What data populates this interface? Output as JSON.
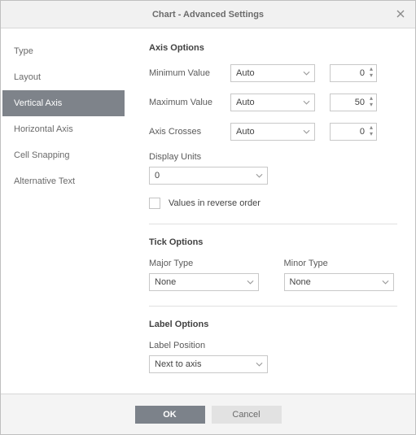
{
  "title": "Chart - Advanced Settings",
  "sidebar": {
    "items": [
      {
        "label": "Type"
      },
      {
        "label": "Layout"
      },
      {
        "label": "Vertical Axis"
      },
      {
        "label": "Horizontal Axis"
      },
      {
        "label": "Cell Snapping"
      },
      {
        "label": "Alternative Text"
      }
    ],
    "active_index": 2
  },
  "axis_options": {
    "heading": "Axis Options",
    "min_label": "Minimum Value",
    "min_mode": "Auto",
    "min_value": "0",
    "max_label": "Maximum Value",
    "max_mode": "Auto",
    "max_value": "50",
    "crosses_label": "Axis Crosses",
    "crosses_mode": "Auto",
    "crosses_value": "0",
    "display_units_label": "Display Units",
    "display_units_value": "0",
    "reverse_label": "Values in reverse order",
    "reverse_checked": false
  },
  "tick_options": {
    "heading": "Tick Options",
    "major_label": "Major Type",
    "major_value": "None",
    "minor_label": "Minor Type",
    "minor_value": "None"
  },
  "label_options": {
    "heading": "Label Options",
    "position_label": "Label Position",
    "position_value": "Next to axis"
  },
  "buttons": {
    "ok": "OK",
    "cancel": "Cancel"
  }
}
